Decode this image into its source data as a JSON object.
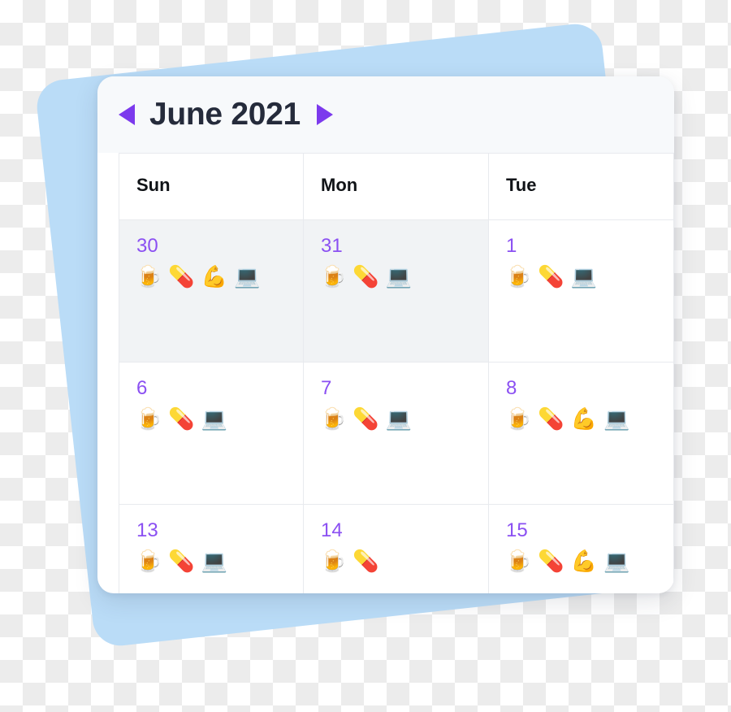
{
  "header": {
    "title": "June 2021",
    "prev_icon": "triangle-left-icon",
    "next_icon": "triangle-right-icon",
    "accent_color": "#7c3aed",
    "title_color": "#252b3b",
    "background_color": "#f7f9fb"
  },
  "theme": {
    "card_background": "#ffffff",
    "backdrop_shape_color": "#badcf7",
    "grid_line_color": "#e8eaee",
    "muted_cell_color": "#f1f3f5",
    "day_number_color": "#8b50f2"
  },
  "weekdays": [
    {
      "label": "Sun"
    },
    {
      "label": "Mon"
    },
    {
      "label": "Tue"
    }
  ],
  "weeks": [
    {
      "days": [
        {
          "number": "30",
          "muted": true,
          "emoji": [
            {
              "name": "beer-mug-icon",
              "glyph": "🍺"
            },
            {
              "name": "pill-icon",
              "glyph": "💊"
            },
            {
              "name": "flexed-biceps-icon",
              "glyph": "💪"
            },
            {
              "name": "laptop-icon",
              "glyph": "💻"
            }
          ]
        },
        {
          "number": "31",
          "muted": true,
          "emoji": [
            {
              "name": "beer-mug-icon",
              "glyph": "🍺"
            },
            {
              "name": "pill-icon",
              "glyph": "💊"
            },
            {
              "name": "laptop-icon",
              "glyph": "💻"
            }
          ]
        },
        {
          "number": "1",
          "muted": false,
          "emoji": [
            {
              "name": "beer-mug-icon",
              "glyph": "🍺"
            },
            {
              "name": "pill-icon",
              "glyph": "💊"
            },
            {
              "name": "laptop-icon",
              "glyph": "💻"
            }
          ]
        }
      ]
    },
    {
      "days": [
        {
          "number": "6",
          "muted": false,
          "emoji": [
            {
              "name": "beer-mug-icon",
              "glyph": "🍺"
            },
            {
              "name": "pill-icon",
              "glyph": "💊"
            },
            {
              "name": "laptop-icon",
              "glyph": "💻"
            }
          ]
        },
        {
          "number": "7",
          "muted": false,
          "emoji": [
            {
              "name": "beer-mug-icon",
              "glyph": "🍺"
            },
            {
              "name": "pill-icon",
              "glyph": "💊"
            },
            {
              "name": "laptop-icon",
              "glyph": "💻"
            }
          ]
        },
        {
          "number": "8",
          "muted": false,
          "emoji": [
            {
              "name": "beer-mug-icon",
              "glyph": "🍺"
            },
            {
              "name": "pill-icon",
              "glyph": "💊"
            },
            {
              "name": "flexed-biceps-icon",
              "glyph": "💪"
            },
            {
              "name": "laptop-icon",
              "glyph": "💻"
            }
          ]
        }
      ]
    },
    {
      "days": [
        {
          "number": "13",
          "muted": false,
          "emoji": [
            {
              "name": "beer-mug-icon",
              "glyph": "🍺"
            },
            {
              "name": "pill-icon",
              "glyph": "💊"
            },
            {
              "name": "laptop-icon",
              "glyph": "💻"
            }
          ]
        },
        {
          "number": "14",
          "muted": false,
          "emoji": [
            {
              "name": "beer-mug-icon",
              "glyph": "🍺"
            },
            {
              "name": "pill-icon",
              "glyph": "💊"
            }
          ]
        },
        {
          "number": "15",
          "muted": false,
          "emoji": [
            {
              "name": "beer-mug-icon",
              "glyph": "🍺"
            },
            {
              "name": "pill-icon",
              "glyph": "💊"
            },
            {
              "name": "flexed-biceps-icon",
              "glyph": "💪"
            },
            {
              "name": "laptop-icon",
              "glyph": "💻"
            }
          ]
        }
      ]
    }
  ]
}
